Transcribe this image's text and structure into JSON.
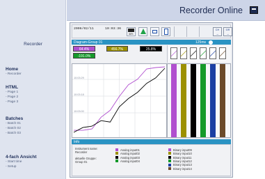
{
  "app": {
    "title": "Recorder Online",
    "brand": "Recorder"
  },
  "nav": [
    {
      "head": "Home",
      "items": [
        "- Recorder"
      ]
    },
    {
      "head": "HTML",
      "items": [
        "- Page 1",
        "- Page 2",
        "- Page 3"
      ]
    },
    {
      "head": "Batches",
      "items": [
        "- Batch 01",
        "- Batch 02",
        "- Batch 03"
      ]
    },
    {
      "head": "4-fach Ansicht",
      "items": [
        "- Start time",
        "- Setup"
      ]
    }
  ],
  "toolbar": {
    "date": "2006/02/11",
    "time": "10:03:36",
    "memory_percent": "88%",
    "channel_button": "CH",
    "group_button": "GR"
  },
  "group": {
    "name": "Diagram-Group 01",
    "speed": "125ms",
    "values": [
      "64.4%",
      "456.7%",
      "25.8%",
      "-191.0%"
    ]
  },
  "colors": {
    "analog1": "#b04fcf",
    "analog2": "#9c9000",
    "analog3": "#000000",
    "analog4": "#159a2a",
    "binary9": "#b04fcf",
    "binary10": "#9c9000",
    "binary11": "#000000",
    "binary12": "#159a2a",
    "binary13": "#1b3fa3",
    "binary14": "#6b4a2a",
    "header": "#2a93c3"
  },
  "chart_data": {
    "type": "line",
    "y_tick_labels": [
      "10:03:29",
      "10:03:18",
      "10:03:00"
    ],
    "series": [
      {
        "values": [
          0.06,
          0.06,
          0.08,
          0.25,
          0.35,
          0.55,
          0.72,
          0.8,
          0.95,
          0.97,
          0.98
        ]
      },
      {
        "values": [
          0.03,
          0.1,
          0.12,
          0.2,
          0.18,
          0.4,
          0.52,
          0.61,
          0.74,
          0.82,
          0.96
        ]
      }
    ]
  },
  "info": {
    "title": "Info",
    "instrument_label": "Instrument name:",
    "instrument_value": "Recorder",
    "group_label": "aktuelle Gruppe:",
    "group_value": "Group 01",
    "analog": [
      "Analog input01",
      "Analog input02",
      "Analog input03",
      "Analog input04"
    ],
    "binary": [
      "Binary input09",
      "Binary input10",
      "Binary input11",
      "Binary input12",
      "Binary input13",
      "Binary input14"
    ]
  }
}
